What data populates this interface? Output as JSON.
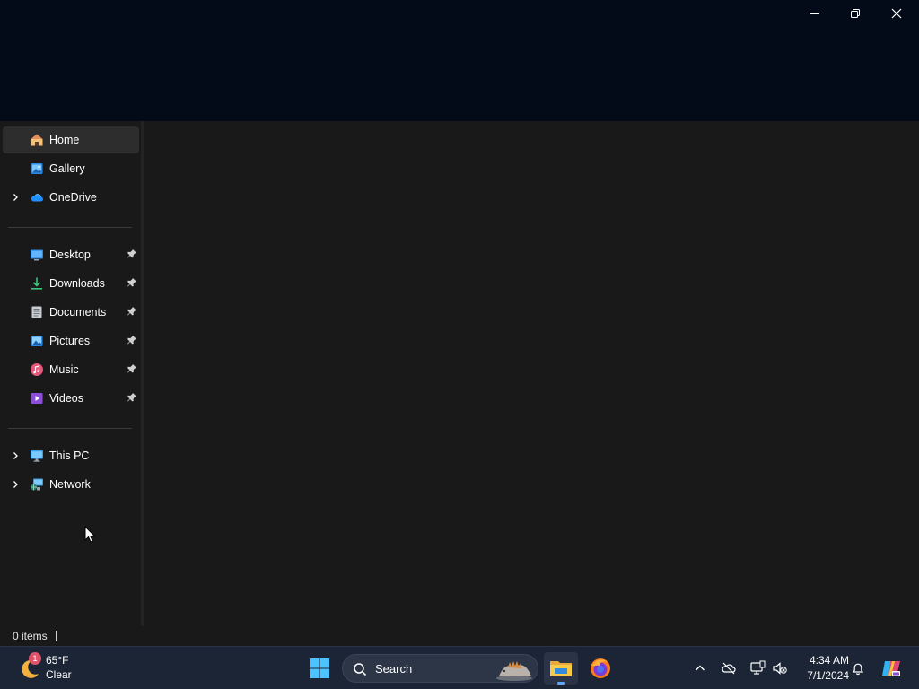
{
  "window": {
    "controls": {
      "minimize_icon": "minimize-icon",
      "restore_icon": "restore-icon",
      "close_icon": "close-icon"
    }
  },
  "sidebar": {
    "top_items": [
      {
        "label": "Home",
        "icon": "home-icon",
        "selected": true
      },
      {
        "label": "Gallery",
        "icon": "gallery-icon"
      },
      {
        "label": "OneDrive",
        "icon": "onedrive-icon",
        "expandable": true
      }
    ],
    "quick_access": [
      {
        "label": "Desktop",
        "icon": "desktop-folder-icon",
        "pinned": true
      },
      {
        "label": "Downloads",
        "icon": "downloads-icon",
        "pinned": true
      },
      {
        "label": "Documents",
        "icon": "documents-icon",
        "pinned": true
      },
      {
        "label": "Pictures",
        "icon": "pictures-icon",
        "pinned": true
      },
      {
        "label": "Music",
        "icon": "music-icon",
        "pinned": true
      },
      {
        "label": "Videos",
        "icon": "videos-icon",
        "pinned": true
      }
    ],
    "bottom_items": [
      {
        "label": "This PC",
        "icon": "this-pc-icon",
        "expandable": true
      },
      {
        "label": "Network",
        "icon": "network-icon",
        "expandable": true
      }
    ]
  },
  "status_bar": {
    "item_count": "0 items"
  },
  "taskbar": {
    "weather": {
      "temperature": "65°F",
      "condition": "Clear",
      "badge": "1"
    },
    "search": {
      "label": "Search"
    },
    "apps": [
      {
        "name": "File Explorer",
        "icon": "file-explorer-icon",
        "active": true
      },
      {
        "name": "Firefox",
        "icon": "firefox-icon",
        "active": false
      }
    ],
    "clock": {
      "time": "4:34 AM",
      "date": "7/1/2024"
    }
  },
  "colors": {
    "titlebar_bg": "#030a18",
    "window_bg": "#191919",
    "selected_bg": "#2d2d2d",
    "taskbar_bg": "#1b2536",
    "accent": "#5ea9ff"
  }
}
